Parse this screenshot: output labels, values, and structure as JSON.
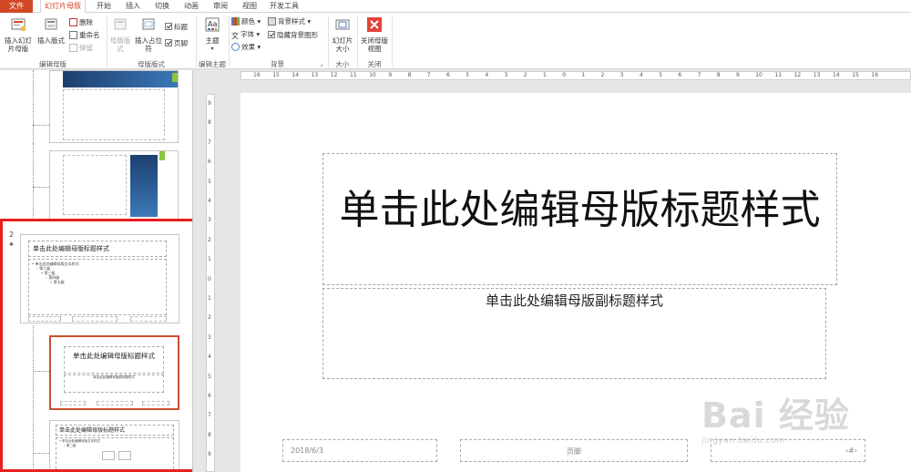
{
  "tabs": {
    "file": "文件",
    "slide_master": "幻灯片母版",
    "home": "开始",
    "insert": "插入",
    "transitions": "切换",
    "animations": "动画",
    "review": "审阅",
    "view": "视图",
    "developer": "开发工具"
  },
  "ribbon": {
    "edit_master": {
      "label": "编辑母版",
      "insert_slide_master": "插入幻灯片母版",
      "insert_layout": "插入版式",
      "delete": "删除",
      "rename": "重命名",
      "preserve": "保留"
    },
    "master_layout": {
      "label": "母版版式",
      "master_layout_btn": "母版版式",
      "insert_placeholder": "插入占位符",
      "title": "标题",
      "footers": "页脚"
    },
    "edit_theme": {
      "label": "编辑主题",
      "themes": "主题"
    },
    "background": {
      "label": "背景",
      "colors": "颜色",
      "fonts": "字体",
      "effects": "效果",
      "background_styles": "背景样式",
      "hide_background_graphics": "隐藏背景图形"
    },
    "size": {
      "label": "大小",
      "slide_size": "幻灯片大小"
    },
    "close": {
      "label": "关闭",
      "close_master_view": "关闭母版视图"
    }
  },
  "thumbnails": {
    "slide_number": "2",
    "master_title": "单击此处编辑母版标题样式",
    "master_body_l1": "• 单击此处编辑母版文本样式",
    "master_body_l2": "– 第二级",
    "master_body_l3": "• 第三级",
    "master_body_l4": "– 第四级",
    "master_body_l5": "» 第五级",
    "layout_title": "单击此处编辑母版标题样式",
    "layout_subtitle": "单击此处编辑母版副标题样式"
  },
  "ruler": {
    "h_ticks": [
      "16",
      "15",
      "14",
      "13",
      "12",
      "11",
      "10",
      "9",
      "8",
      "7",
      "6",
      "5",
      "4",
      "3",
      "2",
      "1",
      "0",
      "1",
      "2",
      "3",
      "4",
      "5",
      "6",
      "7",
      "8",
      "9",
      "10",
      "11",
      "12",
      "13",
      "14",
      "15",
      "16"
    ],
    "v_ticks": [
      "9",
      "8",
      "7",
      "6",
      "5",
      "4",
      "3",
      "2",
      "1",
      "0",
      "1",
      "2",
      "3",
      "4",
      "5",
      "6",
      "7",
      "8",
      "9"
    ]
  },
  "slide": {
    "title": "单击此处编辑母版标题样式",
    "subtitle": "单击此处编辑母版副标题样式",
    "date": "2018/6/3",
    "footer": "页脚",
    "slide_number": "‹#›"
  },
  "watermark": {
    "main": "Bai 经验",
    "sub": "jingyan.baidu.com"
  },
  "colors": {
    "accent": "#d24726",
    "selection_border": "#c8512e",
    "annotation_red": "#e8201e"
  }
}
